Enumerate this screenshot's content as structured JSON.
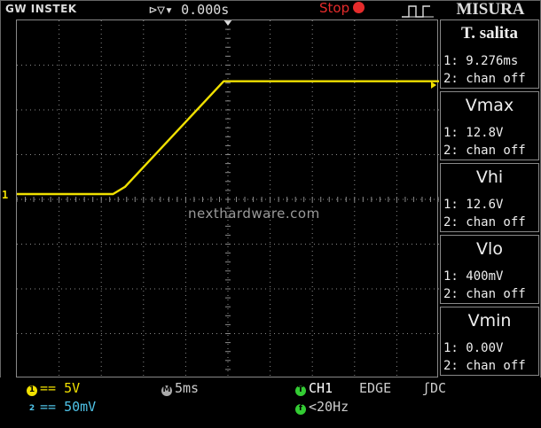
{
  "header": {
    "brand": "GW INSTEK",
    "trigger_readout": "⊳▽▾ 0.000s",
    "run_state": "Stop",
    "menu_title": "MISURA"
  },
  "watermark": "nexthardware.com",
  "channel_marker": "1",
  "measurements": [
    {
      "title": "T. salita",
      "ch1": "1: 9.276ms",
      "ch2": "2: chan off"
    },
    {
      "title": "Vmax",
      "ch1": "1: 12.8V",
      "ch2": "2: chan off"
    },
    {
      "title": "Vhi",
      "ch1": "1: 12.6V",
      "ch2": "2: chan off"
    },
    {
      "title": "Vlo",
      "ch1": "1: 400mV",
      "ch2": "2: chan off"
    },
    {
      "title": "Vmin",
      "ch1": "1: 0.00V",
      "ch2": "2: chan off"
    }
  ],
  "status": {
    "ch1_scale": "== 5V",
    "ch2_scale": "== 50mV",
    "timebase": "5ms",
    "trigger_source": "CH1",
    "trigger_type": "EDGE",
    "coupling": "ʃDC",
    "frequency": "<20Hz",
    "ch1_badge": "1",
    "ch2_badge": "2",
    "timebase_badge": "M",
    "trigger_badge": "T",
    "freq_badge": "f"
  },
  "colors": {
    "ch1": "#f0e000",
    "ch2": "#4fc3e8",
    "stop": "#e52b2b",
    "trigger": "#33cc33",
    "grid": "#8a8a8a"
  },
  "waveform": {
    "description_points_voltage": [
      0.0,
      0.0,
      0.8,
      12.6,
      12.6
    ],
    "time_ms": [
      -25,
      -13.6,
      -12.2,
      -0.5,
      25
    ]
  }
}
